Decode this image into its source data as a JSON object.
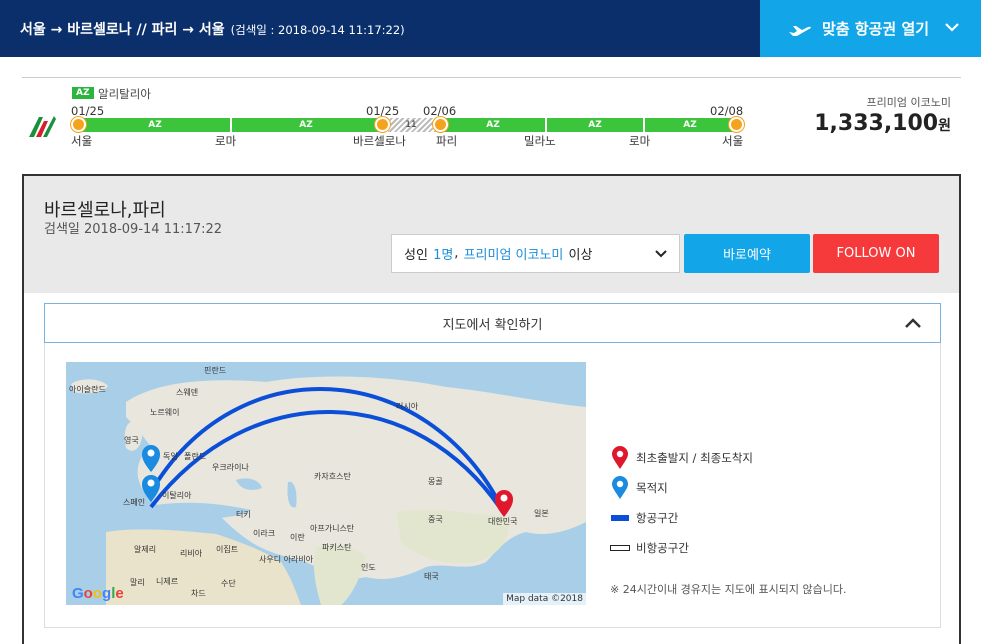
{
  "header": {
    "route": "서울 → 바르셀로나 // 파리 → 서울",
    "search_date": "(검색일 : 2018-09-14 11:17:22)",
    "open_fare_label": "맞춤 항공권 열기"
  },
  "itinerary": {
    "airline_code": "AZ",
    "airline_name": "알리탈리아",
    "dates": [
      "01/25",
      "01/25",
      "02/06",
      "02/08"
    ],
    "cities": [
      "서울",
      "로마",
      "바르셀로나",
      "파리",
      "밀라노",
      "로마",
      "서울"
    ],
    "segment_codes": [
      "AZ",
      "AZ",
      "AZ",
      "AZ",
      "AZ"
    ],
    "gap_label": "11",
    "fare_class": "프리미엄 이코노미",
    "price": "1,333,100",
    "currency": "원"
  },
  "card": {
    "destination": "바르셀로나,파리",
    "search_date": "검색일 2018-09-14 11:17:22",
    "pax_prefix": "성인",
    "pax_count": "1명",
    "pax_sep": ",",
    "pax_class": "프리미엄 이코노미",
    "pax_suffix": "이상",
    "book_label": "바로예약",
    "follow_label": "FOLLOW ON",
    "map_toggle_label": "지도에서 확인하기"
  },
  "map": {
    "labels": [
      "아이슬란드",
      "핀란드",
      "스웨덴",
      "노르웨이",
      "러시아",
      "영국",
      "독일",
      "폴란드",
      "우크라이나",
      "카자흐스탄",
      "몽골",
      "스페인",
      "이탈리아",
      "터키",
      "이라크",
      "이란",
      "아프가니스탄",
      "파키스탄",
      "중국",
      "대한민국",
      "일본",
      "알제리",
      "리비아",
      "이집트",
      "사우디 아라비아",
      "인도",
      "말리",
      "니제르",
      "차드",
      "수단",
      "태국"
    ],
    "google": "Google",
    "map_data": "Map data ©2018"
  },
  "legend": {
    "items": [
      "최초출발지 / 최종도착지",
      "목적지",
      "항공구간",
      "비항공구간"
    ],
    "note": "※ 24시간이내 경유지는 지도에 표시되지 않습니다."
  },
  "colors": {
    "header_bg": "#0a2f6b",
    "accent_blue": "#12a6e8",
    "follow_red": "#f63a3c",
    "segment_green": "#3cc43c",
    "stop_orange": "#f5a21c",
    "route_blue": "#0b4fd9",
    "origin_pin": "#e0182d",
    "dest_pin": "#1a8be0"
  }
}
